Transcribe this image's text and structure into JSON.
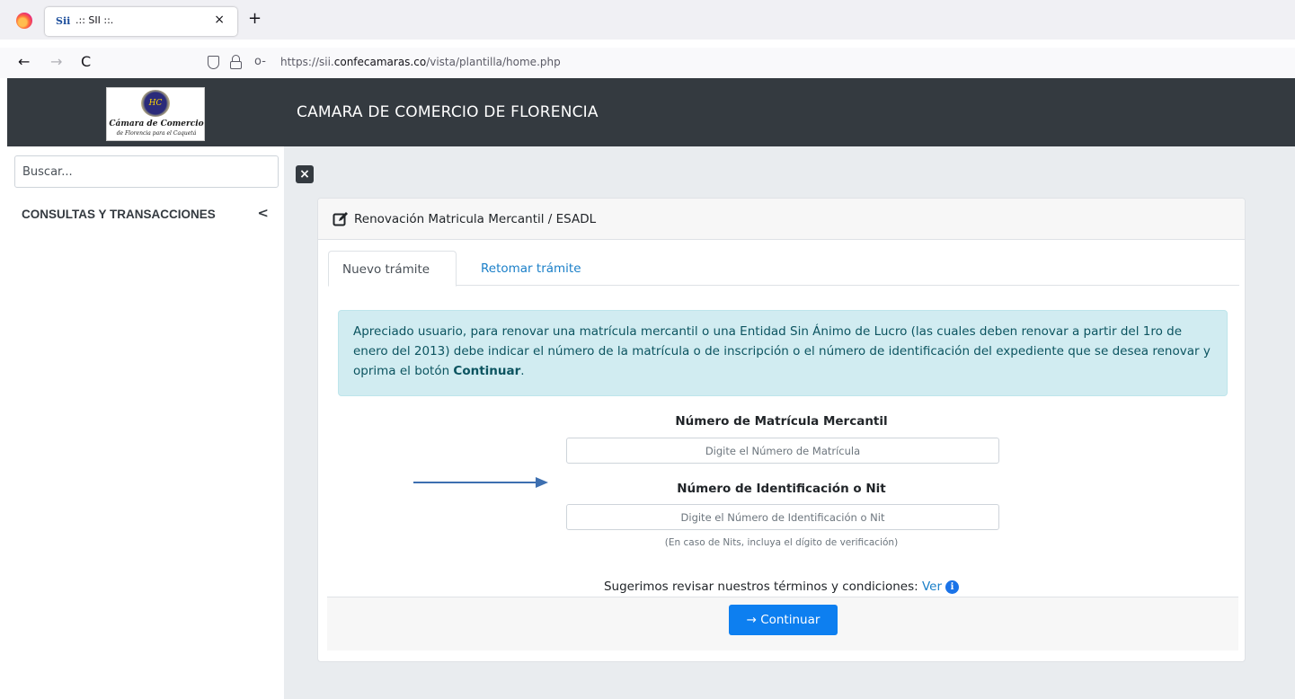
{
  "browser": {
    "tab_favicon": "Sii",
    "tab_title": ".:: SII ::.",
    "tab_close": "×",
    "new_tab": "+",
    "back": "←",
    "forward": "→",
    "reload": "C",
    "key_icon": "o-",
    "url_prefix": "https://sii.",
    "url_host": "confecamaras.co",
    "url_path": "/vista/plantilla/home.php"
  },
  "header": {
    "logo_monogram": "HC",
    "logo_line1": "Cámara de Comercio",
    "logo_line2": "de Florencia para el Caquetá",
    "title": "CAMARA DE COMERCIO DE FLORENCIA"
  },
  "sidebar": {
    "search_placeholder": "Buscar...",
    "section_label": "CONSULTAS Y TRANSACCIONES",
    "section_chevron": "<"
  },
  "main": {
    "close_icon": "×",
    "card_title": "Renovación Matricula Mercantil / ESADL",
    "tabs": [
      {
        "label": "Nuevo trámite",
        "active": true
      },
      {
        "label": "Retomar trámite",
        "active": false
      }
    ],
    "alert": {
      "text_before": "Apreciado usuario, para renovar una matrícula mercantil o una Entidad Sin Ánimo de Lucro (las cuales deben renovar a partir del 1ro de enero del 2013) debe indicar el número de la matrícula o de inscripción o el número de identificación del expediente que se desea renovar y oprima el botón ",
      "text_bold": "Continuar",
      "text_after": "."
    },
    "field_matricula": {
      "label": "Número de Matrícula Mercantil",
      "placeholder": "Digite el Número de Matrícula"
    },
    "field_nit": {
      "label": "Número de Identificación o Nit",
      "placeholder": "Digite el Número de Identificación o Nit",
      "hint": "(En caso de Nits, incluya el dígito de verificación)"
    },
    "terms": {
      "text": "Sugerimos revisar nuestros términos y condiciones: ",
      "link": "Ver",
      "info_icon": "i"
    },
    "continue_button": {
      "arrow": "→",
      "label": "Continuar"
    }
  },
  "colors": {
    "header_bg": "#343a40",
    "accent_blue": "#0d7ff0",
    "alert_bg": "#d1ecf1",
    "alert_text": "#0c5460",
    "annotation_arrow": "#3d6fb0"
  }
}
